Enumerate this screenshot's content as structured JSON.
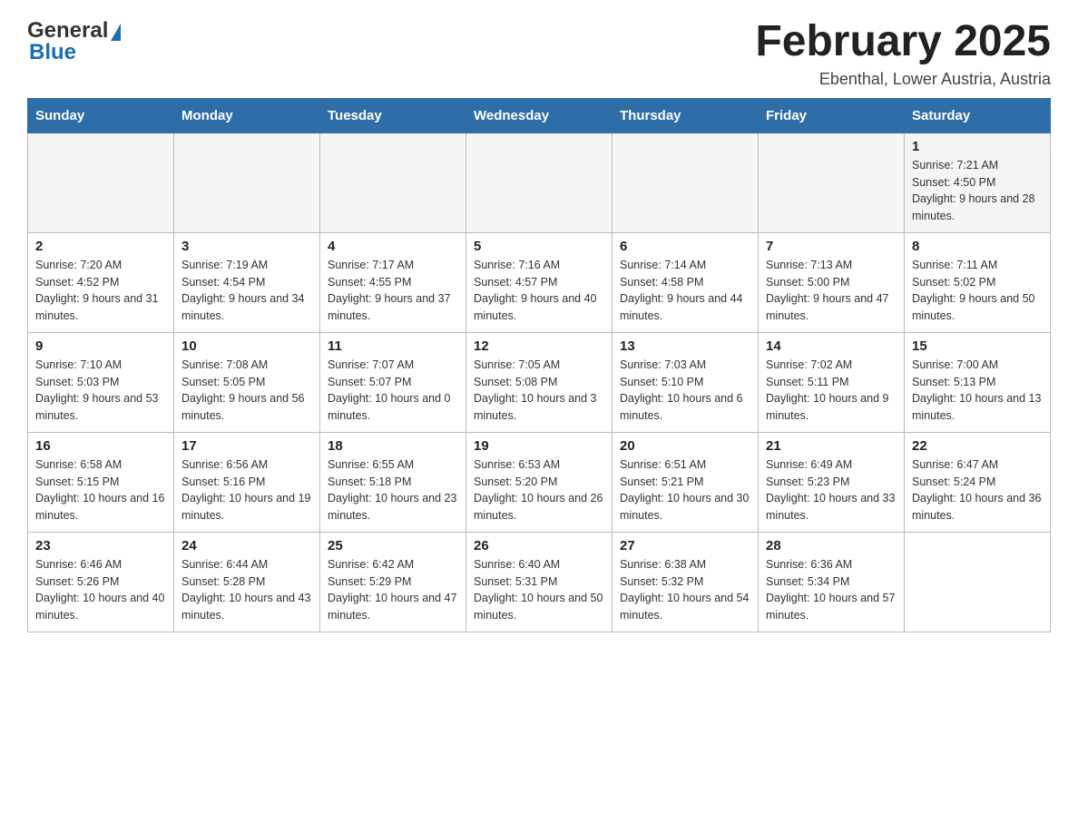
{
  "header": {
    "logo": {
      "general": "General",
      "blue": "Blue"
    },
    "title": "February 2025",
    "location": "Ebenthal, Lower Austria, Austria"
  },
  "calendar": {
    "days_of_week": [
      "Sunday",
      "Monday",
      "Tuesday",
      "Wednesday",
      "Thursday",
      "Friday",
      "Saturday"
    ],
    "weeks": [
      [
        {
          "day": "",
          "info": ""
        },
        {
          "day": "",
          "info": ""
        },
        {
          "day": "",
          "info": ""
        },
        {
          "day": "",
          "info": ""
        },
        {
          "day": "",
          "info": ""
        },
        {
          "day": "",
          "info": ""
        },
        {
          "day": "1",
          "info": "Sunrise: 7:21 AM\nSunset: 4:50 PM\nDaylight: 9 hours and 28 minutes."
        }
      ],
      [
        {
          "day": "2",
          "info": "Sunrise: 7:20 AM\nSunset: 4:52 PM\nDaylight: 9 hours and 31 minutes."
        },
        {
          "day": "3",
          "info": "Sunrise: 7:19 AM\nSunset: 4:54 PM\nDaylight: 9 hours and 34 minutes."
        },
        {
          "day": "4",
          "info": "Sunrise: 7:17 AM\nSunset: 4:55 PM\nDaylight: 9 hours and 37 minutes."
        },
        {
          "day": "5",
          "info": "Sunrise: 7:16 AM\nSunset: 4:57 PM\nDaylight: 9 hours and 40 minutes."
        },
        {
          "day": "6",
          "info": "Sunrise: 7:14 AM\nSunset: 4:58 PM\nDaylight: 9 hours and 44 minutes."
        },
        {
          "day": "7",
          "info": "Sunrise: 7:13 AM\nSunset: 5:00 PM\nDaylight: 9 hours and 47 minutes."
        },
        {
          "day": "8",
          "info": "Sunrise: 7:11 AM\nSunset: 5:02 PM\nDaylight: 9 hours and 50 minutes."
        }
      ],
      [
        {
          "day": "9",
          "info": "Sunrise: 7:10 AM\nSunset: 5:03 PM\nDaylight: 9 hours and 53 minutes."
        },
        {
          "day": "10",
          "info": "Sunrise: 7:08 AM\nSunset: 5:05 PM\nDaylight: 9 hours and 56 minutes."
        },
        {
          "day": "11",
          "info": "Sunrise: 7:07 AM\nSunset: 5:07 PM\nDaylight: 10 hours and 0 minutes."
        },
        {
          "day": "12",
          "info": "Sunrise: 7:05 AM\nSunset: 5:08 PM\nDaylight: 10 hours and 3 minutes."
        },
        {
          "day": "13",
          "info": "Sunrise: 7:03 AM\nSunset: 5:10 PM\nDaylight: 10 hours and 6 minutes."
        },
        {
          "day": "14",
          "info": "Sunrise: 7:02 AM\nSunset: 5:11 PM\nDaylight: 10 hours and 9 minutes."
        },
        {
          "day": "15",
          "info": "Sunrise: 7:00 AM\nSunset: 5:13 PM\nDaylight: 10 hours and 13 minutes."
        }
      ],
      [
        {
          "day": "16",
          "info": "Sunrise: 6:58 AM\nSunset: 5:15 PM\nDaylight: 10 hours and 16 minutes."
        },
        {
          "day": "17",
          "info": "Sunrise: 6:56 AM\nSunset: 5:16 PM\nDaylight: 10 hours and 19 minutes."
        },
        {
          "day": "18",
          "info": "Sunrise: 6:55 AM\nSunset: 5:18 PM\nDaylight: 10 hours and 23 minutes."
        },
        {
          "day": "19",
          "info": "Sunrise: 6:53 AM\nSunset: 5:20 PM\nDaylight: 10 hours and 26 minutes."
        },
        {
          "day": "20",
          "info": "Sunrise: 6:51 AM\nSunset: 5:21 PM\nDaylight: 10 hours and 30 minutes."
        },
        {
          "day": "21",
          "info": "Sunrise: 6:49 AM\nSunset: 5:23 PM\nDaylight: 10 hours and 33 minutes."
        },
        {
          "day": "22",
          "info": "Sunrise: 6:47 AM\nSunset: 5:24 PM\nDaylight: 10 hours and 36 minutes."
        }
      ],
      [
        {
          "day": "23",
          "info": "Sunrise: 6:46 AM\nSunset: 5:26 PM\nDaylight: 10 hours and 40 minutes."
        },
        {
          "day": "24",
          "info": "Sunrise: 6:44 AM\nSunset: 5:28 PM\nDaylight: 10 hours and 43 minutes."
        },
        {
          "day": "25",
          "info": "Sunrise: 6:42 AM\nSunset: 5:29 PM\nDaylight: 10 hours and 47 minutes."
        },
        {
          "day": "26",
          "info": "Sunrise: 6:40 AM\nSunset: 5:31 PM\nDaylight: 10 hours and 50 minutes."
        },
        {
          "day": "27",
          "info": "Sunrise: 6:38 AM\nSunset: 5:32 PM\nDaylight: 10 hours and 54 minutes."
        },
        {
          "day": "28",
          "info": "Sunrise: 6:36 AM\nSunset: 5:34 PM\nDaylight: 10 hours and 57 minutes."
        },
        {
          "day": "",
          "info": ""
        }
      ]
    ]
  }
}
